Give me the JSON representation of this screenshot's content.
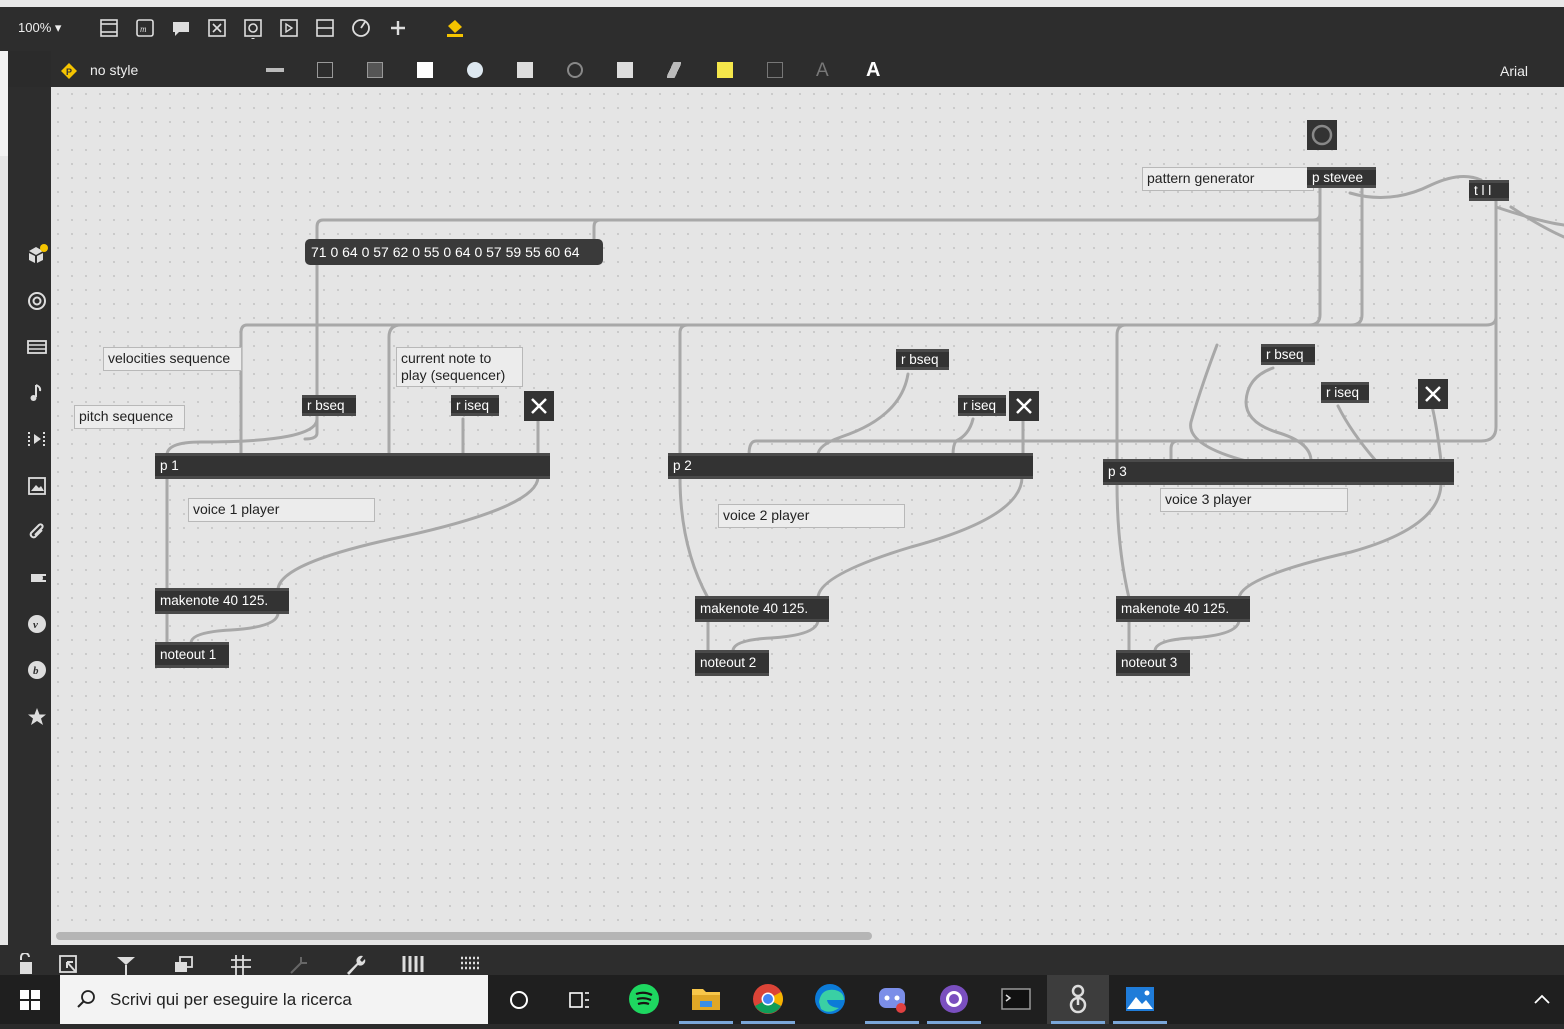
{
  "toolbar": {
    "zoom": "100%",
    "icons": [
      "presentation-icon",
      "text-object-icon",
      "comment-icon",
      "toggle-icon",
      "button-icon",
      "message-icon",
      "slider-icon",
      "dial-icon",
      "add-icon",
      "paint-bucket-icon"
    ]
  },
  "style_bar": {
    "style_name": "no style",
    "font_name": "Arial"
  },
  "patch": {
    "sequence_message": "71 0 64 0 57 62 0 55 0 64 0 57 59 55 60 64",
    "pattern_generator_comment": "pattern generator",
    "p_stevee": "p stevee",
    "t_ll": "t l l",
    "velocities_comment": "velocities sequence",
    "pitch_comment": "pitch sequence",
    "current_note_comment": "current note to play (sequencer)",
    "r_bseq": "r bseq",
    "r_iseq": "r iseq",
    "p1": "p 1",
    "p2": "p 2",
    "p3": "p 3",
    "voice1_comment": "voice 1 player",
    "voice2_comment": "voice 2 player",
    "voice3_comment": "voice 3 player",
    "makenote": "makenote 40 125.",
    "noteout1": "noteout 1",
    "noteout2": "noteout 2",
    "noteout3": "noteout 3"
  },
  "taskbar": {
    "search_placeholder": "Scrivi qui per eseguire la ricerca",
    "apps": [
      "spotify",
      "file-explorer",
      "chrome",
      "edge",
      "discord",
      "github-desktop",
      "terminal",
      "max",
      "photos"
    ]
  },
  "colors": {
    "canvas": "#e5e5e5",
    "object": "#333333",
    "patchcord": "#a8a8a8",
    "accent": "#f5c400"
  }
}
